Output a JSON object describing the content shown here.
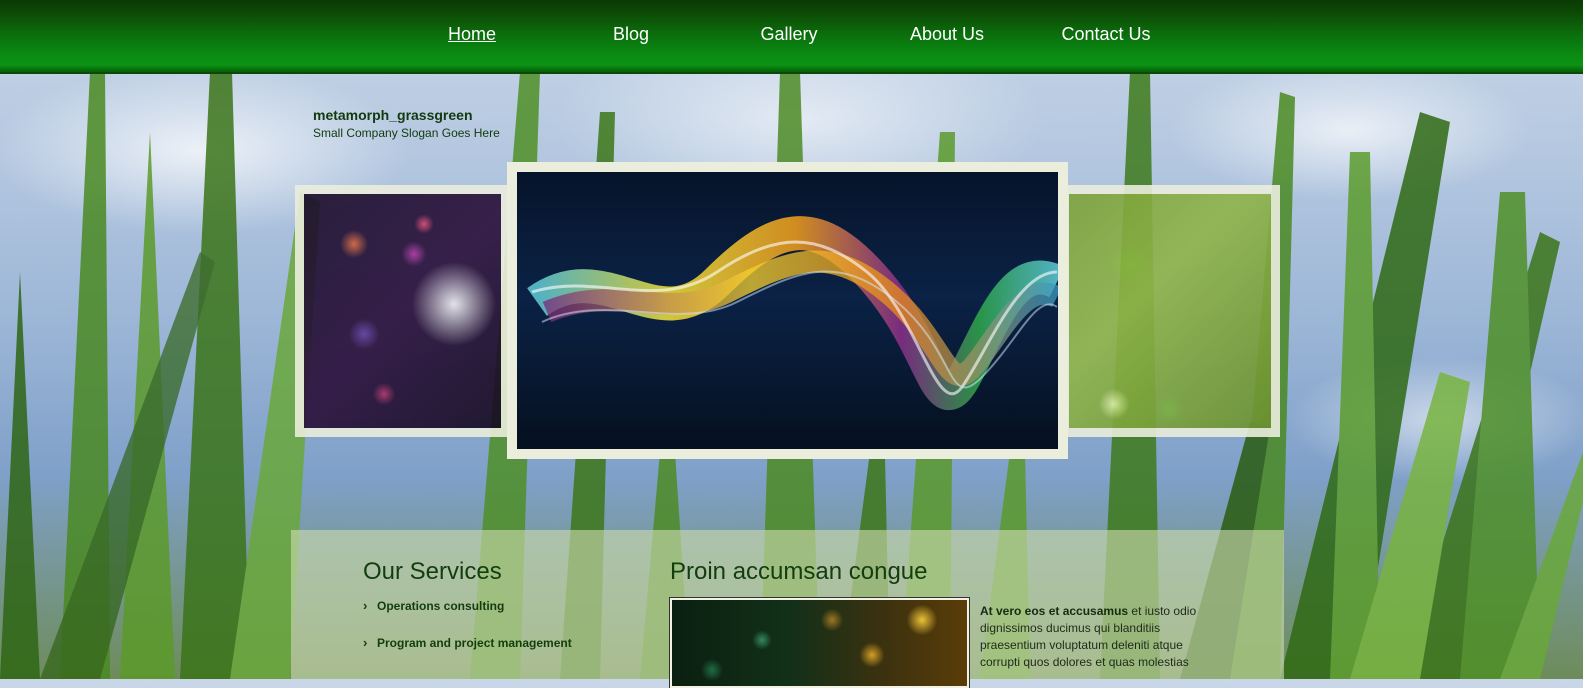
{
  "nav": {
    "items": [
      {
        "label": "Home",
        "active": true
      },
      {
        "label": "Blog"
      },
      {
        "label": "Gallery"
      },
      {
        "label": "About Us"
      },
      {
        "label": "Contact Us"
      }
    ]
  },
  "brand": {
    "name": "metamorph_grassgreen",
    "slogan": "Small Company Slogan Goes Here"
  },
  "services": {
    "heading": "Our Services",
    "items": [
      "Operations consulting",
      "Program and project management"
    ]
  },
  "article": {
    "heading": "Proin accumsan congue",
    "lead_bold": "At vero eos et accusamus",
    "body": " et iusto odio dignissimos ducimus qui blanditiis praesentium voluptatum deleniti atque corrupti quos dolores et quas molestias"
  },
  "colors": {
    "nav_green": "#0a8a12",
    "text_dark_green": "#143d0e",
    "frame": "#eceedd"
  }
}
